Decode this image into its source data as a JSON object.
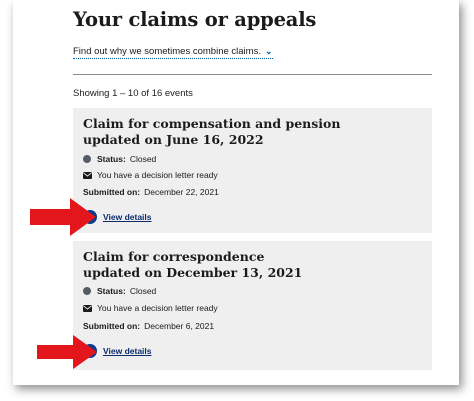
{
  "page": {
    "title": "Your claims or appeals",
    "combine_link": "Find out why we sometimes combine claims.",
    "showing": "Showing 1 – 10 of 16 events"
  },
  "claims": [
    {
      "title_line1": "Claim for compensation and pension",
      "title_line2": "updated on June 16, 2022",
      "status_label": "Status:",
      "status_value": "Closed",
      "decision": "You have a decision letter ready",
      "submitted_label": "Submitted on:",
      "submitted_value": "December 22, 2021",
      "view_details": "View details"
    },
    {
      "title_line1": "Claim for correspondence",
      "title_line2": "updated on December 13, 2021",
      "status_label": "Status:",
      "status_value": "Closed",
      "decision": "You have a decision letter ready",
      "submitted_label": "Submitted on:",
      "submitted_value": "December 6, 2021",
      "view_details": "View details"
    }
  ],
  "colors": {
    "card_bg": "#efefef",
    "link_blue": "#0b3a8c",
    "annotation_arrow": "#e3161b"
  }
}
